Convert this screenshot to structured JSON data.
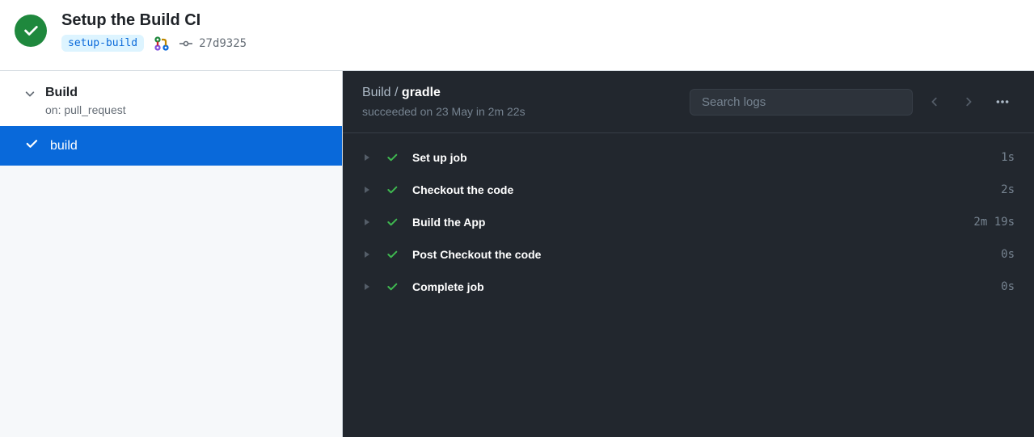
{
  "header": {
    "title": "Setup the Build CI",
    "branch": "setup-build",
    "commit_sha": "27d9325"
  },
  "sidebar": {
    "workflow_name": "Build",
    "event_label": "on: pull_request",
    "jobs": [
      {
        "name": "build",
        "active": true
      }
    ]
  },
  "content": {
    "breadcrumb_prefix": "Build / ",
    "breadcrumb_current": "gradle",
    "subtitle": "succeeded on 23 May in 2m 22s",
    "search_placeholder": "Search logs",
    "steps": [
      {
        "name": "Set up job",
        "duration": "1s"
      },
      {
        "name": "Checkout the code",
        "duration": "2s"
      },
      {
        "name": "Build the App",
        "duration": "2m 19s"
      },
      {
        "name": "Post Checkout the code",
        "duration": "0s"
      },
      {
        "name": "Complete job",
        "duration": "0s"
      }
    ]
  }
}
